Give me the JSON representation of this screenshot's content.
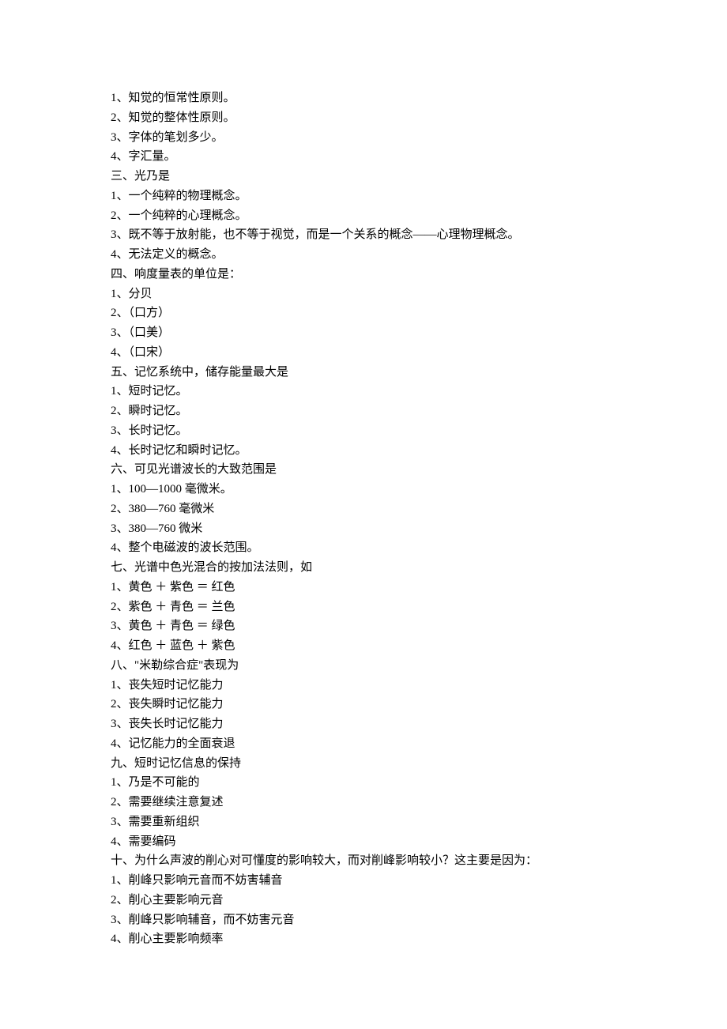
{
  "lines": [
    "1、知觉的恒常性原则。",
    "2、知觉的整体性原则。",
    "3、字体的笔划多少。",
    "4、字汇量。",
    "三、光乃是",
    "1、一个纯粹的物理概念。",
    "2、一个纯粹的心理概念。",
    "3、既不等于放射能，也不等于视觉，而是一个关系的概念——心理物理概念。",
    "4、无法定义的概念。",
    "四、响度量表的单位是：",
    "1、分贝",
    "2、（口方）",
    "3、（口美）",
    "4、（口宋）",
    "五、记忆系统中，储存能量最大是",
    "1、短时记忆。",
    "2、瞬时记忆。",
    "3、长时记忆。",
    "4、长时记忆和瞬时记忆。",
    "六、可见光谱波长的大致范围是",
    "1、100—1000 毫微米。",
    "2、380—760 毫微米",
    "3、380—760 微米",
    "4、整个电磁波的波长范围。",
    "七、光谱中色光混合的按加法法则，如",
    "1、黄色 ＋ 紫色 ＝ 红色",
    "2、紫色 ＋ 青色 ＝ 兰色",
    "3、黄色 ＋ 青色 ＝ 绿色",
    "4、红色 ＋ 蓝色 ＋ 紫色",
    "八、\"米勒综合症\"表现为",
    "1、丧失短时记忆能力",
    "2、丧失瞬时记忆能力",
    "3、丧失长时记忆能力",
    "4、记忆能力的全面衰退",
    "九、短时记忆信息的保持",
    "1、乃是不可能的",
    "2、需要继续注意复述",
    "3、需要重新组织",
    "4、需要编码",
    "十、为什么声波的削心对可懂度的影响较大，而对削峰影响较小？这主要是因为：",
    "1、削峰只影响元音而不妨害辅音",
    "2、削心主要影响元音",
    "3、削峰只影响辅音，而不妨害元音",
    "4、削心主要影响频率"
  ]
}
